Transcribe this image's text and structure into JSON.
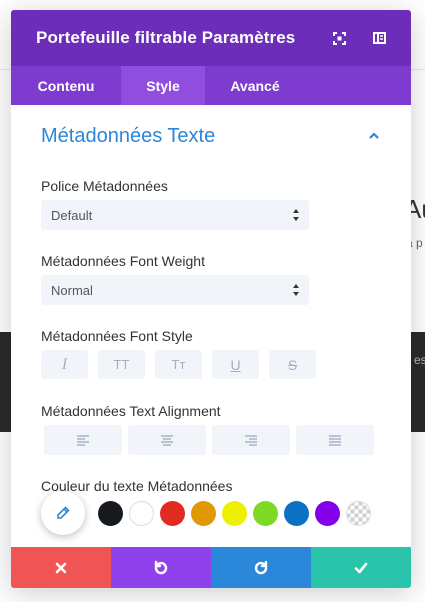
{
  "background": {
    "heading_fragment": "Au",
    "sub_fragment": "a p",
    "dark_fragment": "es"
  },
  "modal": {
    "title": "Portefeuille filtrable Paramètres",
    "tabs": [
      {
        "label": "Contenu",
        "active": false
      },
      {
        "label": "Style",
        "active": true
      },
      {
        "label": "Avancé",
        "active": false
      }
    ],
    "section_title": "Métadonnées Texte",
    "fields": {
      "font": {
        "label": "Police Métadonnées",
        "value": "Default"
      },
      "weight": {
        "label": "Métadonnées Font Weight",
        "value": "Normal"
      },
      "style": {
        "label": "Métadonnées Font Style",
        "buttons": [
          "I",
          "TT",
          "Tт",
          "U",
          "S"
        ]
      },
      "alignment": {
        "label": "Métadonnées Text Alignment",
        "buttons": [
          "left",
          "center",
          "right",
          "justify"
        ]
      },
      "color": {
        "label": "Couleur du texte Métadonnées"
      }
    },
    "swatches": [
      "#161a1f",
      "#ffffff",
      "#e02b20",
      "#e09900",
      "#edf000",
      "#7cda24",
      "#0c71c3",
      "#8300e9",
      "transparent"
    ]
  },
  "colors": {
    "header": "#6c2eb9",
    "tabs": "#7d3bcf",
    "accent": "#2b87da",
    "cancel": "#ef5555",
    "undo": "#8f42ec",
    "redo": "#2b87da",
    "save": "#29c4a9"
  }
}
